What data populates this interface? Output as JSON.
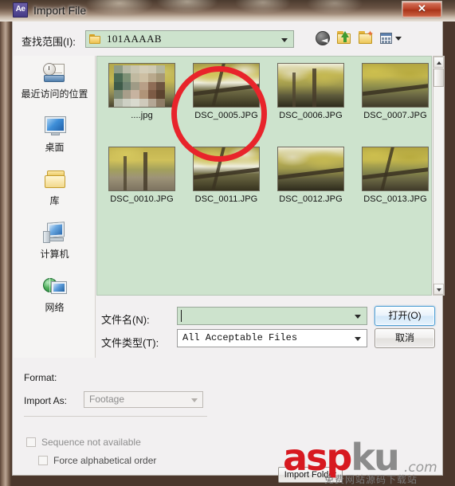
{
  "window": {
    "app_icon": "ae-icon",
    "title": "Import File",
    "close_label": "✕"
  },
  "toolbar": {
    "lookin_label": "查找范围(I):",
    "current_folder": "101AAAAB",
    "folder_icon": "folder-icon",
    "dropdown_icon": "chevron-down-icon",
    "back_icon": "back-arrow-icon",
    "up_icon": "up-folder-icon",
    "new_folder_icon": "new-folder-icon",
    "views_icon": "views-grid-icon",
    "views_dropdown_icon": "chevron-down-icon"
  },
  "places": {
    "items": [
      {
        "label": "最近访问的位置",
        "icon": "recent-places-icon"
      },
      {
        "label": "桌面",
        "icon": "desktop-monitor-icon"
      },
      {
        "label": "库",
        "icon": "library-folder-icon"
      },
      {
        "label": "计算机",
        "icon": "computer-icon"
      },
      {
        "label": "网络",
        "icon": "network-globe-icon"
      }
    ]
  },
  "file_list": {
    "files": [
      {
        "label": "....jpg",
        "thumb": "censored-mosaic"
      },
      {
        "label": "DSC_0005.JPG",
        "thumb": "ginkgo-branch"
      },
      {
        "label": "DSC_0006.JPG",
        "thumb": "ginkgo-trunk"
      },
      {
        "label": "DSC_0007.JPG",
        "thumb": "ginkgo-canopy"
      },
      {
        "label": "DSC_0010.JPG",
        "thumb": "park-path"
      },
      {
        "label": "DSC_0011.JPG",
        "thumb": "ginkgo-branch"
      },
      {
        "label": "DSC_0012.JPG",
        "thumb": "ginkgo-canopy"
      },
      {
        "label": "DSC_0013.JPG",
        "thumb": "ginkgo-branch"
      }
    ],
    "scrollbar": {
      "up_icon": "scroll-up-icon",
      "down_icon": "scroll-down-icon"
    }
  },
  "form": {
    "filename_label": "文件名(N):",
    "filename_value": "",
    "filetype_label": "文件类型(T):",
    "filetype_value": "All Acceptable Files",
    "open_button": "打开(O)",
    "cancel_button": "取消"
  },
  "format_panel": {
    "format_label": "Format:",
    "format_value": "",
    "import_as_label": "Import As:",
    "import_as_value": "Footage",
    "sequence_checkbox": "Sequence not available",
    "force_alpha_checkbox": "Force alphabetical order",
    "import_folder_button": "Import Folder"
  },
  "annotation": {
    "circle_target": "DSC_0005.JPG"
  },
  "watermark": {
    "part1": "asp",
    "part2": "ku",
    "part3": ".com",
    "subtitle": "免费网站源码下载站",
    "color_primary": "#d71920",
    "color_secondary": "#8b8b8b"
  },
  "colors": {
    "list_background": "#cde3cd",
    "dialog_background": "#f2f0f1",
    "annotation_red": "#e8242b",
    "frame_brown": "#6a5445"
  }
}
